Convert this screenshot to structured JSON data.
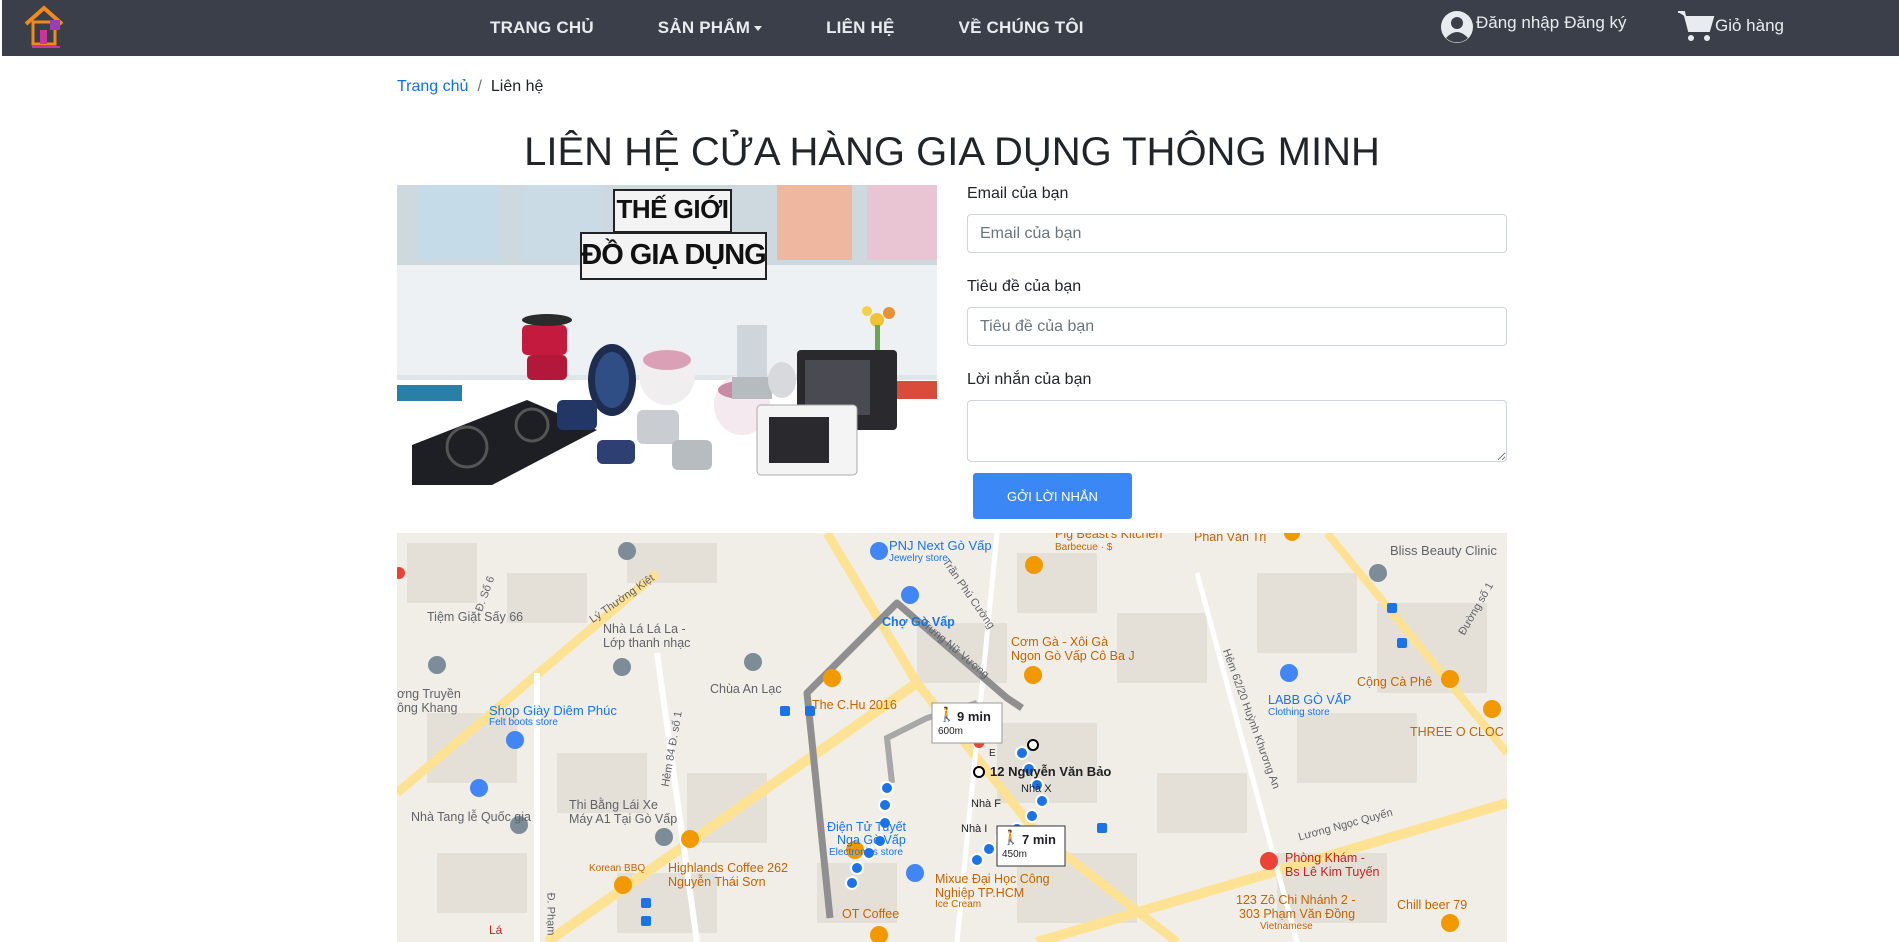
{
  "navbar": {
    "logo_icon": "house-logo-icon",
    "links": [
      {
        "label": "TRANG CHỦ"
      },
      {
        "label": "SẢN PHẨM",
        "has_dropdown": true
      },
      {
        "label": "LIÊN HỆ"
      },
      {
        "label": "VỀ CHÚNG TÔI"
      }
    ],
    "account": {
      "icon": "user-circle-icon",
      "login_label": "Đăng nhập",
      "register_label": "Đăng ký"
    },
    "cart": {
      "icon": "shopping-cart-icon",
      "label": "Giỏ hàng"
    }
  },
  "breadcrumb": {
    "home": "Trang chủ",
    "separator": "/",
    "current": "Liên hệ"
  },
  "page_title": "LIÊN HỆ CỬA HÀNG GIA DỤNG THÔNG MINH",
  "promo": {
    "line1": "THẾ GIỚI",
    "line2": "ĐỒ GIA DỤNG"
  },
  "form": {
    "email_label": "Email của bạn",
    "email_placeholder": "Email của bạn",
    "subject_label": "Tiêu đề của bạn",
    "subject_placeholder": "Tiêu đề của bạn",
    "message_label": "Lời nhắn của bạn",
    "submit_label": "GỞI LỜI NHẮN"
  },
  "map": {
    "labels": [
      {
        "text": "PNJ Next Gò Vấp",
        "sub": "Jewelry store"
      },
      {
        "text": "Bliss Beauty Clinic"
      },
      {
        "text": "Phan Văn Trị"
      },
      {
        "text": "Tiệm Giặt Sấy 66"
      },
      {
        "text": "Nhà Lá Lá La -"
      },
      {
        "text": "Lớp thanh nhạc"
      },
      {
        "text": "Chợ Gò Vấp"
      },
      {
        "text": "Cơm Gà - Xôi Gà"
      },
      {
        "text": "Ngon Gò Vấp Cô Ba J"
      },
      {
        "text": "Chùa An Lạc"
      },
      {
        "text": "ơng Truyền"
      },
      {
        "text": "ông Khang"
      },
      {
        "text": "Shop Giày Diêm Phúc",
        "sub": "Felt boots store"
      },
      {
        "text": "The C.Hu 2016"
      },
      {
        "text": "LABB GÒ VẤP",
        "sub": "Clothing store"
      },
      {
        "text": "Cộng Cà Phê"
      },
      {
        "text": "THREE O CLOC"
      },
      {
        "text": "12 Nguyễn Văn Bảo"
      },
      {
        "text": "Nhà X"
      },
      {
        "text": "Nhà F"
      },
      {
        "text": "Nhà I"
      },
      {
        "text": "Thi Bằng Lái Xe"
      },
      {
        "text": "Máy A1 Tại Gò Vấp"
      },
      {
        "text": "Nhà Tang lễ Quốc gia"
      },
      {
        "text": "Điện Tử Tuyết"
      },
      {
        "text": "Nga Gò Vấp",
        "sub": "Electronics store"
      },
      {
        "text": "Highlands Coffee 262"
      },
      {
        "text": "Nguyễn Thái Sơn"
      },
      {
        "text": "Korean BBQ"
      },
      {
        "text": "Mixue Đại Học Công"
      },
      {
        "text": "Nghiệp TP.HCM",
        "sub": "Ice Cream"
      },
      {
        "text": "OT Coffee"
      },
      {
        "text": "Lương Ngọc Quyến"
      },
      {
        "text": "Phòng Khám -"
      },
      {
        "text": "Bs Lê Kim Tuyến"
      },
      {
        "text": "123 Zô Chi Nhánh 2 -"
      },
      {
        "text": "303 Phạm Văn Đồng",
        "sub": "Vietnamese"
      },
      {
        "text": "Chill beer 79"
      },
      {
        "text": "Trần Phú Cường"
      },
      {
        "text": "Trưng Nữ Vương"
      },
      {
        "text": "Lý Thường Kiệt"
      },
      {
        "text": "Đ. Số 6"
      },
      {
        "text": "Hẻm 84 Đ. số 1"
      },
      {
        "text": "Hẻm 62/20 Huỳnh Khương An"
      },
      {
        "text": "Đường số 1"
      },
      {
        "text": "Đ. Phạm"
      },
      {
        "text": "Lá"
      },
      {
        "text": "Pig Beast's Kitchen",
        "sub": "Barbecue · $"
      }
    ],
    "routes": [
      {
        "duration": "9 min",
        "distance": "600m",
        "icon": "walking-icon"
      },
      {
        "duration": "7 min",
        "distance": "450m",
        "icon": "walking-icon"
      }
    ],
    "route_letter": "E"
  }
}
